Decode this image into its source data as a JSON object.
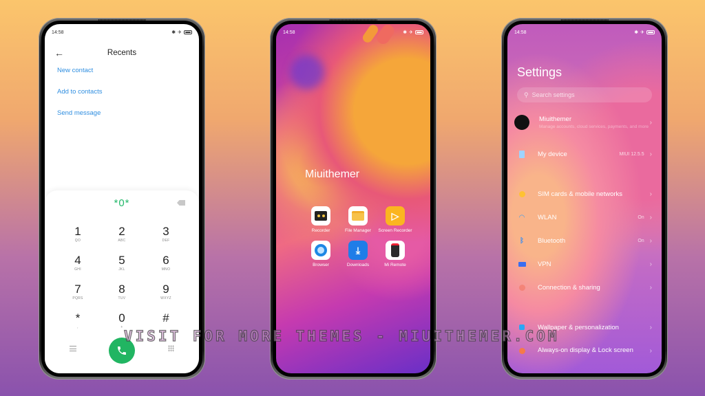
{
  "colors": {
    "accent_link": "#2f8ee0",
    "dialer_green": "#21b562",
    "dialed_text": "#23b86a"
  },
  "phone1": {
    "status": {
      "time": "14:58",
      "icons": [
        "bluetooth-icon",
        "airplane-icon",
        "battery-icon"
      ]
    },
    "header": {
      "back_icon": "←",
      "title": "Recents"
    },
    "menu": [
      {
        "label": "New contact"
      },
      {
        "label": "Add to contacts"
      },
      {
        "label": "Send message"
      }
    ],
    "dialed": "*0*",
    "keys": [
      {
        "digit": "1",
        "letters": "QO"
      },
      {
        "digit": "2",
        "letters": "ABC"
      },
      {
        "digit": "3",
        "letters": "DEF"
      },
      {
        "digit": "4",
        "letters": "GHI"
      },
      {
        "digit": "5",
        "letters": "JKL"
      },
      {
        "digit": "6",
        "letters": "MNO"
      },
      {
        "digit": "7",
        "letters": "PQRS"
      },
      {
        "digit": "8",
        "letters": "TUV"
      },
      {
        "digit": "9",
        "letters": "WXYZ"
      },
      {
        "digit": "*",
        "letters": ","
      },
      {
        "digit": "0",
        "letters": "+"
      },
      {
        "digit": "#",
        "letters": ""
      }
    ]
  },
  "phone2": {
    "status": {
      "time": "14:58"
    },
    "title": "Miuithemer",
    "apps": [
      {
        "name": "Recorder",
        "icon": "recorder-icon"
      },
      {
        "name": "File Manager",
        "icon": "folder-icon"
      },
      {
        "name": "Screen Recorder",
        "icon": "screen-recorder-icon"
      },
      {
        "name": "Browser",
        "icon": "browser-icon"
      },
      {
        "name": "Downloads",
        "icon": "download-icon"
      },
      {
        "name": "Mi Remote",
        "icon": "remote-icon"
      }
    ]
  },
  "phone3": {
    "status": {
      "time": "14:58"
    },
    "title": "Settings",
    "search_placeholder": "Search settings",
    "account": {
      "name": "Miuithemer",
      "sub": "Manage accounts, cloud services, payments, and more"
    },
    "items": [
      {
        "label": "My device",
        "value": "MIUI 12.5.5",
        "icon": "phone-icon"
      },
      {
        "label": "SIM cards & mobile networks",
        "value": "",
        "icon": "sim-icon"
      },
      {
        "label": "WLAN",
        "value": "On",
        "icon": "wifi-icon"
      },
      {
        "label": "Bluetooth",
        "value": "On",
        "icon": "bluetooth-icon"
      },
      {
        "label": "VPN",
        "value": "",
        "icon": "vpn-icon"
      },
      {
        "label": "Connection & sharing",
        "value": "",
        "icon": "share-icon"
      },
      {
        "label": "Wallpaper & personalization",
        "value": "",
        "icon": "wallpaper-icon"
      },
      {
        "label": "Always-on display & Lock screen",
        "value": "",
        "icon": "lock-icon"
      }
    ]
  },
  "watermark": "VISIT FOR MORE THEMES - MIUITHEMER.COM"
}
